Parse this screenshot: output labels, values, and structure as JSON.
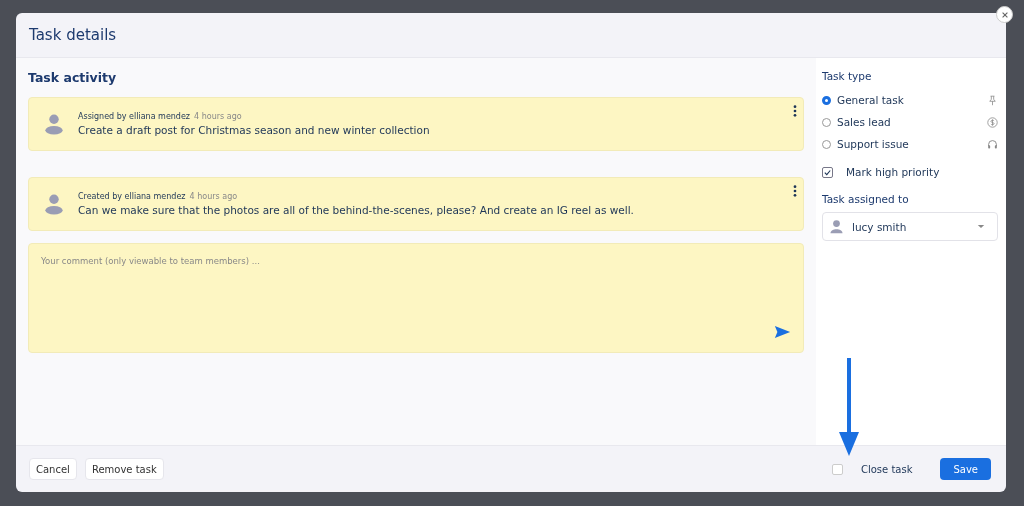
{
  "dialog": {
    "title": "Task details"
  },
  "activity": {
    "heading": "Task activity",
    "comments": [
      {
        "author": "Assigned by elliana mendez",
        "time": "4 hours ago",
        "text": "Create a draft post for Christmas season and new winter collection"
      },
      {
        "author": "Created by elliana mendez",
        "time": "4 hours ago",
        "text": "Can we make sure that the photos are all of the behind-the-scenes, please? And create an IG reel as well."
      }
    ],
    "comment_field": {
      "placeholder": "Your comment (only viewable to team members) ..."
    }
  },
  "task_type": {
    "label": "Task type",
    "options": [
      {
        "label": "General task",
        "selected": true
      },
      {
        "label": "Sales lead",
        "selected": false
      },
      {
        "label": "Support issue",
        "selected": false
      }
    ]
  },
  "high_priority": {
    "label": "Mark high priority",
    "checked": true
  },
  "assignee": {
    "label": "Task assigned to",
    "value": "lucy smith"
  },
  "footer": {
    "cancel": "Cancel",
    "remove": "Remove task",
    "close_task": {
      "label": "Close task",
      "checked": false
    },
    "save": "Save"
  }
}
